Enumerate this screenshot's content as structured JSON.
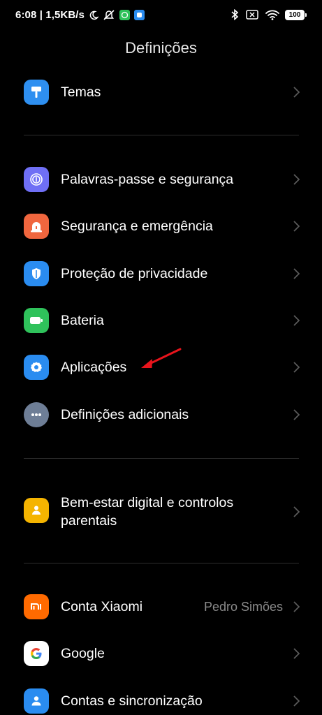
{
  "status_bar": {
    "time_speed": "6:08 | 1,5KB/s",
    "battery": "100"
  },
  "page_title": "Definições",
  "items": [
    {
      "label": "Temas",
      "icon": "paint-roller-icon",
      "color": "#2e8ff0"
    },
    {
      "label": "Palavras-passe e segurança",
      "icon": "fingerprint-icon",
      "color": "#6f6ff5"
    },
    {
      "label": "Segurança e emergência",
      "icon": "emergency-light-icon",
      "color": "#f0663e"
    },
    {
      "label": "Proteção de privacidade",
      "icon": "privacy-shield-icon",
      "color": "#2a8cf0"
    },
    {
      "label": "Bateria",
      "icon": "battery-icon",
      "color": "#2fc25b"
    },
    {
      "label": "Aplicações",
      "icon": "gear-icon",
      "color": "#2a8cf0"
    },
    {
      "label": "Definições adicionais",
      "icon": "more-dots-icon",
      "color": "#6e7e96"
    },
    {
      "label": "Bem-estar digital e controlos parentais",
      "icon": "wellbeing-icon",
      "color": "#f5b400"
    },
    {
      "label": "Conta Xiaomi",
      "value": "Pedro Simões",
      "icon": "xiaomi-mi-icon",
      "color": "#ff6a00"
    },
    {
      "label": "Google",
      "icon": "google-icon",
      "color": "#ffffff"
    },
    {
      "label": "Contas e sincronização",
      "icon": "account-icon",
      "color": "#2a8cf0"
    }
  ],
  "annotation_color": "#e8141c"
}
